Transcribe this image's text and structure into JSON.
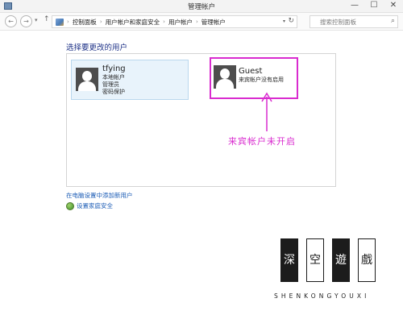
{
  "window": {
    "title": "管理帐户",
    "minimize": "—",
    "maximize": "☐",
    "close": "✕"
  },
  "nav": {
    "back": "←",
    "forward": "→",
    "history": "▾",
    "up": "↑",
    "breadcrumbs": [
      "控制面板",
      "用户帐户和家庭安全",
      "用户帐户",
      "管理帐户"
    ],
    "separator": "›",
    "dropdown": "▾",
    "refresh": "↻",
    "search_placeholder": "搜索控制面板",
    "search_icon": "⌕"
  },
  "main": {
    "heading": "选择要更改的用户",
    "accounts": [
      {
        "name": "tfying",
        "lines": [
          "本地帐户",
          "管理员",
          "密码保护"
        ]
      },
      {
        "name": "Guest",
        "lines": [
          "来宾帐户没有启用"
        ]
      }
    ],
    "annotation": "来宾帐户未开启",
    "annotation_color": "#d92bcf",
    "link_add_user": "在电脑设置中添加新用户",
    "link_family_safety": "设置家庭安全"
  },
  "watermark": {
    "chars": [
      "深",
      "空",
      "遊",
      "戲"
    ],
    "subtitle": "SHENKONGYOUXI"
  },
  "colors": {
    "heading": "#1e3287",
    "link": "#1a5bb5",
    "highlight": "#d92bcf",
    "selected_card": "#e8f3fb"
  }
}
